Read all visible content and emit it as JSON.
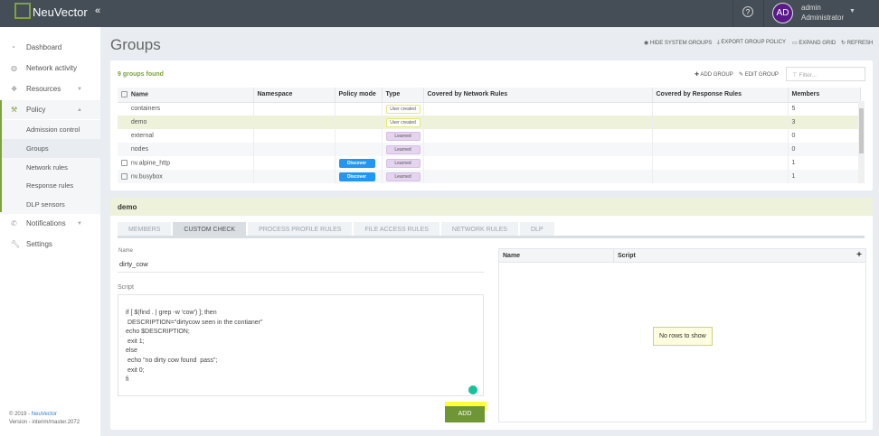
{
  "header": {
    "brand": "NeuVector",
    "collapse_icon": "double-chevron-left-icon",
    "help_icon": "question-circle-icon",
    "avatar": "AD",
    "user": "admin",
    "role": "Administrator"
  },
  "sidebar": {
    "items": [
      {
        "label": "Dashboard",
        "icon": "gauge-icon"
      },
      {
        "label": "Network activity",
        "icon": "globe-icon"
      },
      {
        "label": "Resources",
        "icon": "cubes-icon"
      },
      {
        "label": "Policy",
        "icon": "gavel-icon"
      },
      {
        "label": "Notifications",
        "icon": "phone-icon"
      },
      {
        "label": "Settings",
        "icon": "wrench-icon"
      }
    ],
    "policy_sub": [
      "Admission control",
      "Groups",
      "Network rules",
      "Response rules",
      "DLP sensors"
    ],
    "footer_copy": "© 2019 - ",
    "footer_link": "NeuVector",
    "version": "Version - interim/master.2072"
  },
  "page": {
    "title": "Groups",
    "actions": [
      "HIDE SYSTEM GROUPS",
      "EXPORT GROUP POLICY",
      "EXPAND GRID",
      "REFRESH"
    ]
  },
  "groups": {
    "count": "9 groups found",
    "add": "ADD GROUP",
    "edit": "EDIT GROUP",
    "filter_placeholder": "Filter...",
    "columns": [
      "Name",
      "Namespace",
      "Policy mode",
      "Type",
      "Covered by Network Rules",
      "Covered by Response Rules",
      "Members"
    ],
    "rows": [
      {
        "name": "containers",
        "namespace": "",
        "mode": "",
        "type": "User created",
        "members": "5",
        "checkbox": false
      },
      {
        "name": "demo",
        "namespace": "",
        "mode": "",
        "type": "User created",
        "members": "3",
        "checkbox": false
      },
      {
        "name": "external",
        "namespace": "",
        "mode": "",
        "type": "Learned",
        "members": "0",
        "checkbox": false
      },
      {
        "name": "nodes",
        "namespace": "",
        "mode": "",
        "type": "Learned",
        "members": "0",
        "checkbox": false
      },
      {
        "name": "nv.alpine_http",
        "namespace": "",
        "mode": "Discover",
        "type": "Learned",
        "members": "1",
        "checkbox": true
      },
      {
        "name": "nv.busybox",
        "namespace": "",
        "mode": "Discover",
        "type": "Learned",
        "members": "1",
        "checkbox": true
      }
    ]
  },
  "detail": {
    "title": "demo",
    "tabs": [
      "MEMBERS",
      "CUSTOM CHECK",
      "PROCESS PROFILE RULES",
      "FILE ACCESS RULES",
      "NETWORK RULES",
      "DLP"
    ],
    "active_tab": "CUSTOM CHECK",
    "name_label": "Name",
    "name_value": "dirty_cow",
    "script_label": "Script",
    "script": "if [ $(find . | grep -w 'cow') ]; then\n DESCRIPTION=\"dirtycow seen in the contianer\"\necho $DESCRIPTION;\n exit 1;\nelse\n echo \"no dirty cow found  pass\";\n exit 0;\nfi",
    "add_label": "ADD",
    "grid_columns": [
      "Name",
      "Script"
    ],
    "no_rows": "No rows to show"
  }
}
